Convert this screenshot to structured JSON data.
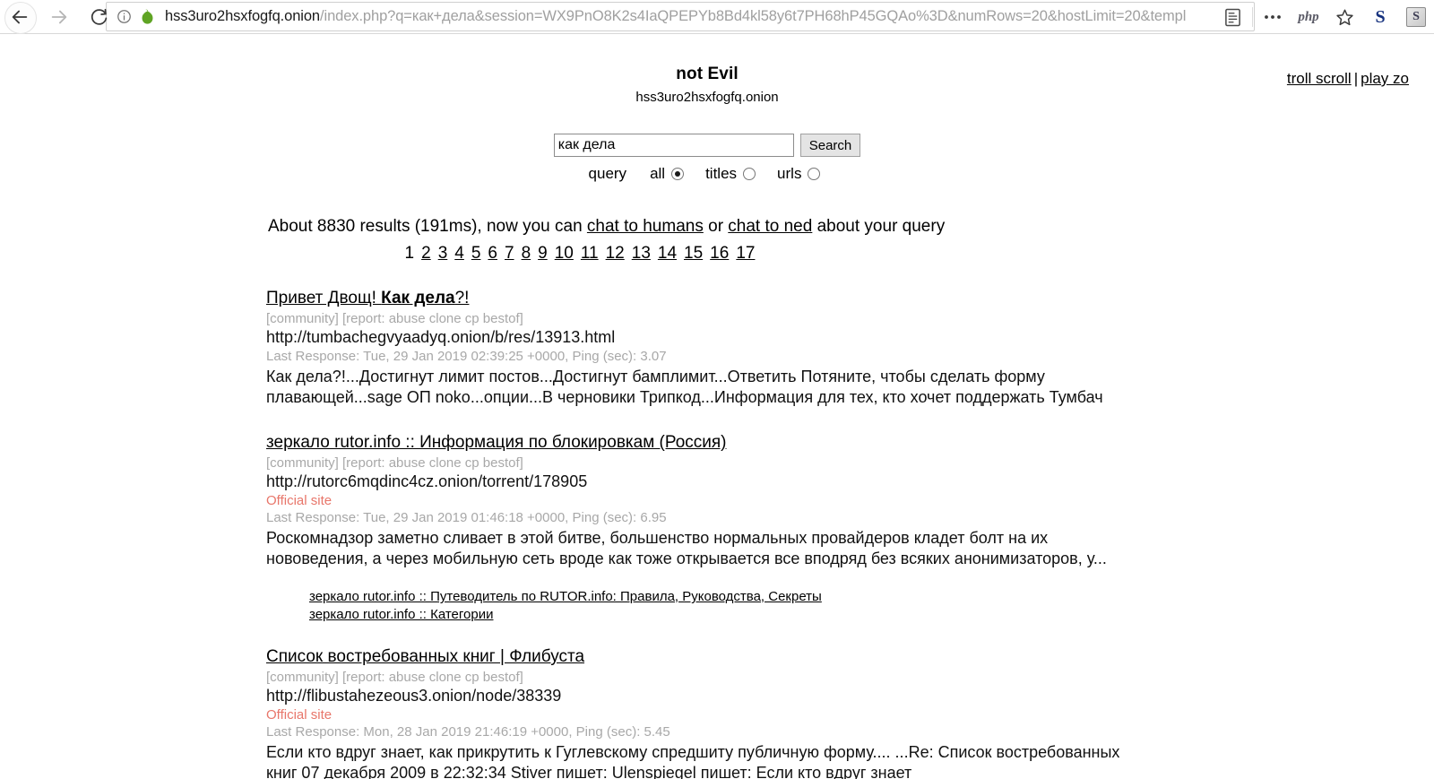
{
  "browser": {
    "back_label": "back",
    "forward_label": "forward",
    "reload_label": "reload",
    "info_label": "site-information",
    "url_host": "hss3uro2hsxfogfq.onion",
    "url_path": "/index.php?q=как+дела&session=WX9PnO8K2s4IaQPEPYb8Bd4kl58y6t7PH68hP45GQAo%3D&numRows=20&hostLimit=20&templ",
    "reader_label": "reader-view",
    "more_label": "more",
    "php_label": "php",
    "bookmark_label": "bookmark",
    "ext_s_label": "S",
    "ext_badge_label": "S"
  },
  "toplinks": {
    "troll_scroll": "troll scroll",
    "separator": "|",
    "play_zo": "play zo"
  },
  "header": {
    "title": "not Evil",
    "subtitle": "hss3uro2hsxfogfq.onion"
  },
  "search": {
    "value": "как дела",
    "placeholder": "",
    "button": "Search",
    "query_label": "query",
    "options": [
      {
        "label": "all",
        "checked": true
      },
      {
        "label": "titles",
        "checked": false
      },
      {
        "label": "urls",
        "checked": false
      }
    ]
  },
  "results_info": {
    "prefix": "About 8830 results (191ms), now you can ",
    "link1": "chat to humans",
    "middle": " or ",
    "link2": "chat to ned",
    "suffix": " about your query",
    "count": "8830",
    "time": "191ms"
  },
  "pagination": {
    "pages": [
      "1",
      "2",
      "3",
      "4",
      "5",
      "6",
      "7",
      "8",
      "9",
      "10",
      "11",
      "12",
      "13",
      "14",
      "15",
      "16",
      "17"
    ],
    "current": "1"
  },
  "results": [
    {
      "title_plain_1": "Привет Двощ! ",
      "title_bold": "Как дела",
      "title_plain_2": "?!",
      "tags": "[community] [report: abuse clone cp bestof]",
      "url": "http://tumbachegvyaadyq.onion/b/res/13913.html",
      "official": "",
      "meta": "Last Response: Tue, 29 Jan 2019 02:39:25 +0000, Ping (sec): 3.07",
      "snippet": "Как дела?!...Достигнут лимит постов...Достигнут бамплимит...Ответить Потяните, чтобы сделать форму плавающей...sage ОП noko...опции...В черновики Трипкод...Информация для тех, кто хочет поддержать Тумбач",
      "sublinks": []
    },
    {
      "title_plain_1": "зеркало rutor.info :: Информация по блокировкам (Россия)",
      "title_bold": "",
      "title_plain_2": "",
      "tags": "[community] [report: abuse clone cp bestof]",
      "url": "http://rutorc6mqdinc4cz.onion/torrent/178905",
      "official": "Official site",
      "meta": "Last Response: Tue, 29 Jan 2019 01:46:18 +0000, Ping (sec): 6.95",
      "snippet": "Роскомнадзор заметно сливает в этой битве, большенство нормальных провайдеров кладет болт на их нововедения, а через мобильную сеть вроде как тоже открывается все вподряд без всяких анонимизаторов, у...",
      "sublinks": [
        "зеркало rutor.info :: Путеводитель по RUTOR.info: Правила, Руководства, Секреты",
        "зеркало rutor.info :: Категории"
      ]
    },
    {
      "title_plain_1": "Список востребованных книг | Флибуста",
      "title_bold": "",
      "title_plain_2": "",
      "tags": "[community] [report: abuse clone cp bestof]",
      "url": "http://flibustahezeous3.onion/node/38339",
      "official": "Official site",
      "meta": "Last Response: Mon, 28 Jan 2019 21:46:19 +0000, Ping (sec): 5.45",
      "snippet": "Если кто вдруг знает, как прикрутить к Гуглевскому спредшиту публичную форму.... ...Re: Список востребованных книг  07 декабря 2009  в 22:32:34 Stiver пишет:   Ulenspiegel пишет:   Если кто вдруг знает",
      "sublinks": []
    }
  ],
  "colors": {
    "official_site": "#e8766a",
    "meta_gray": "#a8a8a8",
    "onion_green": "#5fa424",
    "link_black": "#000000"
  }
}
